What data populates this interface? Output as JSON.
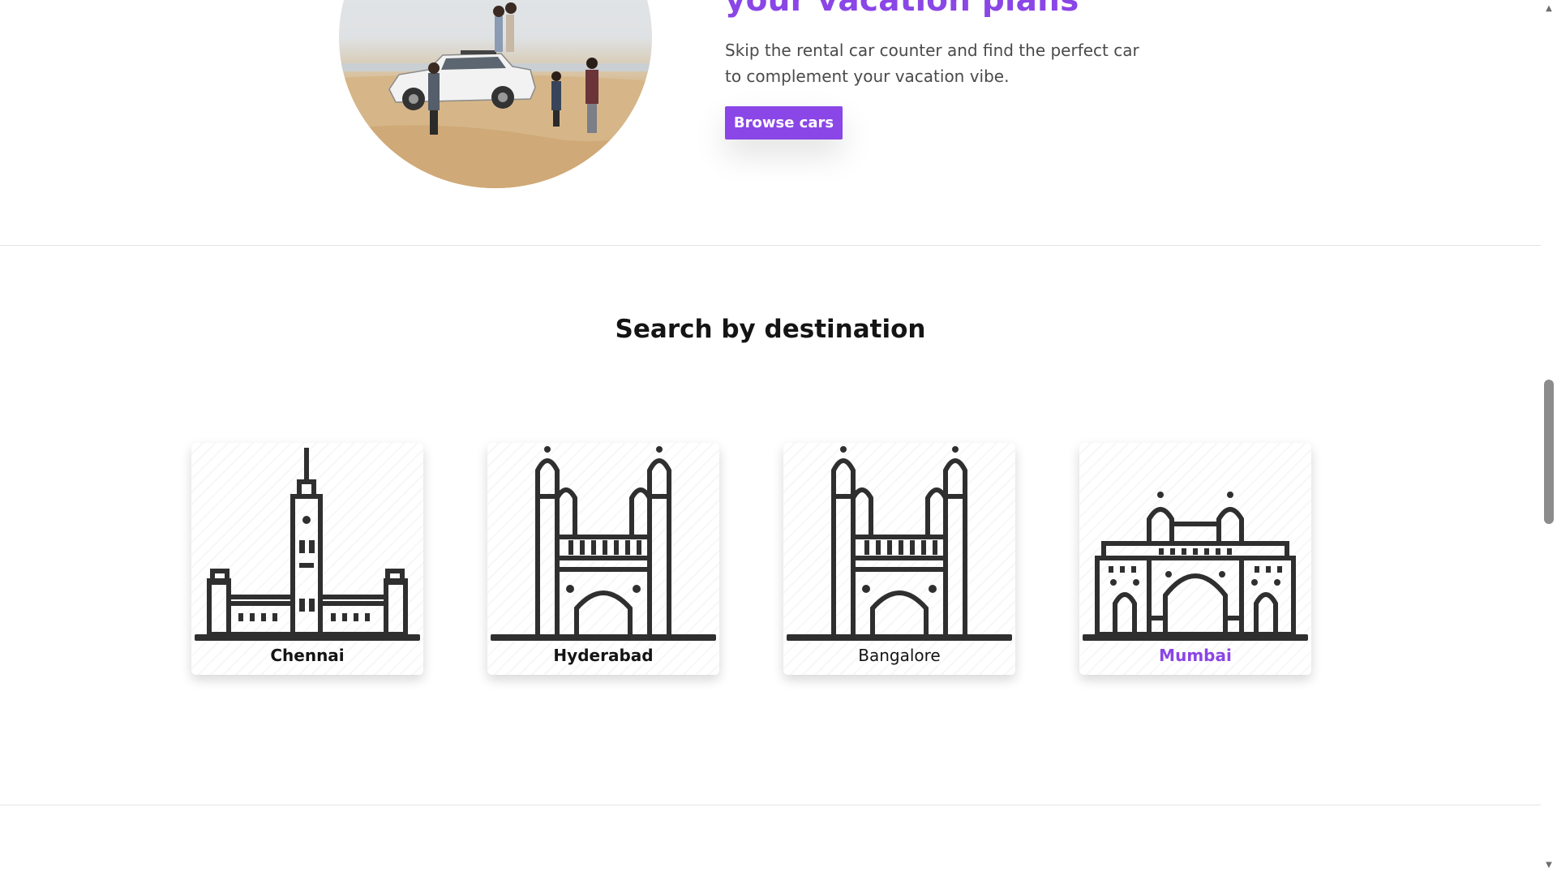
{
  "hero": {
    "title": "your vacation plans",
    "description": "Skip the rental car counter and find the perfect car to complement your vacation vibe.",
    "button_label": "Browse cars"
  },
  "destinations": {
    "title": "Search by destination",
    "cards": [
      {
        "label": "Chennai",
        "icon": "chennai-landmark-icon"
      },
      {
        "label": "Hyderabad",
        "icon": "charminar-icon"
      },
      {
        "label": "Bangalore",
        "icon": "charminar-icon",
        "style": "regular-weight"
      },
      {
        "label": "Mumbai",
        "icon": "gateway-of-india-icon",
        "state": "hovered"
      }
    ]
  },
  "colors": {
    "accent": "#8a46e6",
    "icon": "#2f2f2f",
    "text": "#141414",
    "muted_text": "#4a4a4a"
  },
  "scrollbar": {
    "icons": [
      "scroll-up-arrow-icon",
      "scroll-down-arrow-icon"
    ]
  }
}
